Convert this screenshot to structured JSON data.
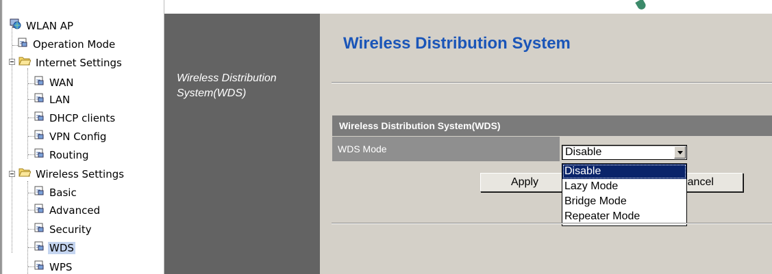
{
  "tree": {
    "root": "WLAN AP",
    "items": [
      {
        "label": "Operation Mode",
        "type": "page",
        "level": 1
      },
      {
        "label": "Internet Settings",
        "type": "folder",
        "level": 0
      },
      {
        "label": "WAN",
        "type": "page",
        "level": 2
      },
      {
        "label": "LAN",
        "type": "page",
        "level": 2
      },
      {
        "label": "DHCP clients",
        "type": "page",
        "level": 2
      },
      {
        "label": "VPN Config",
        "type": "page",
        "level": 2
      },
      {
        "label": "Routing",
        "type": "page",
        "level": 2
      },
      {
        "label": "Wireless Settings",
        "type": "folder",
        "level": 0
      },
      {
        "label": "Basic",
        "type": "page",
        "level": 2
      },
      {
        "label": "Advanced",
        "type": "page",
        "level": 2
      },
      {
        "label": "Security",
        "type": "page",
        "level": 2
      },
      {
        "label": "WDS",
        "type": "page",
        "level": 2,
        "selected": true
      },
      {
        "label": "WPS",
        "type": "page",
        "level": 2
      }
    ]
  },
  "sidebar_title": "Wireless Distribution System(WDS)",
  "page_title": "Wireless Distribution System",
  "table": {
    "header": "Wireless Distribution System(WDS)",
    "row_label": "WDS Mode"
  },
  "select": {
    "value": "Disable",
    "options": [
      "Disable",
      "Lazy Mode",
      "Bridge Mode",
      "Repeater Mode"
    ],
    "highlighted": "Disable"
  },
  "buttons": {
    "apply": "Apply",
    "cancel": "Cancel"
  },
  "colors": {
    "title_blue": "#1a55b8",
    "selection": "#0a246a",
    "panel_grey": "#636363"
  }
}
